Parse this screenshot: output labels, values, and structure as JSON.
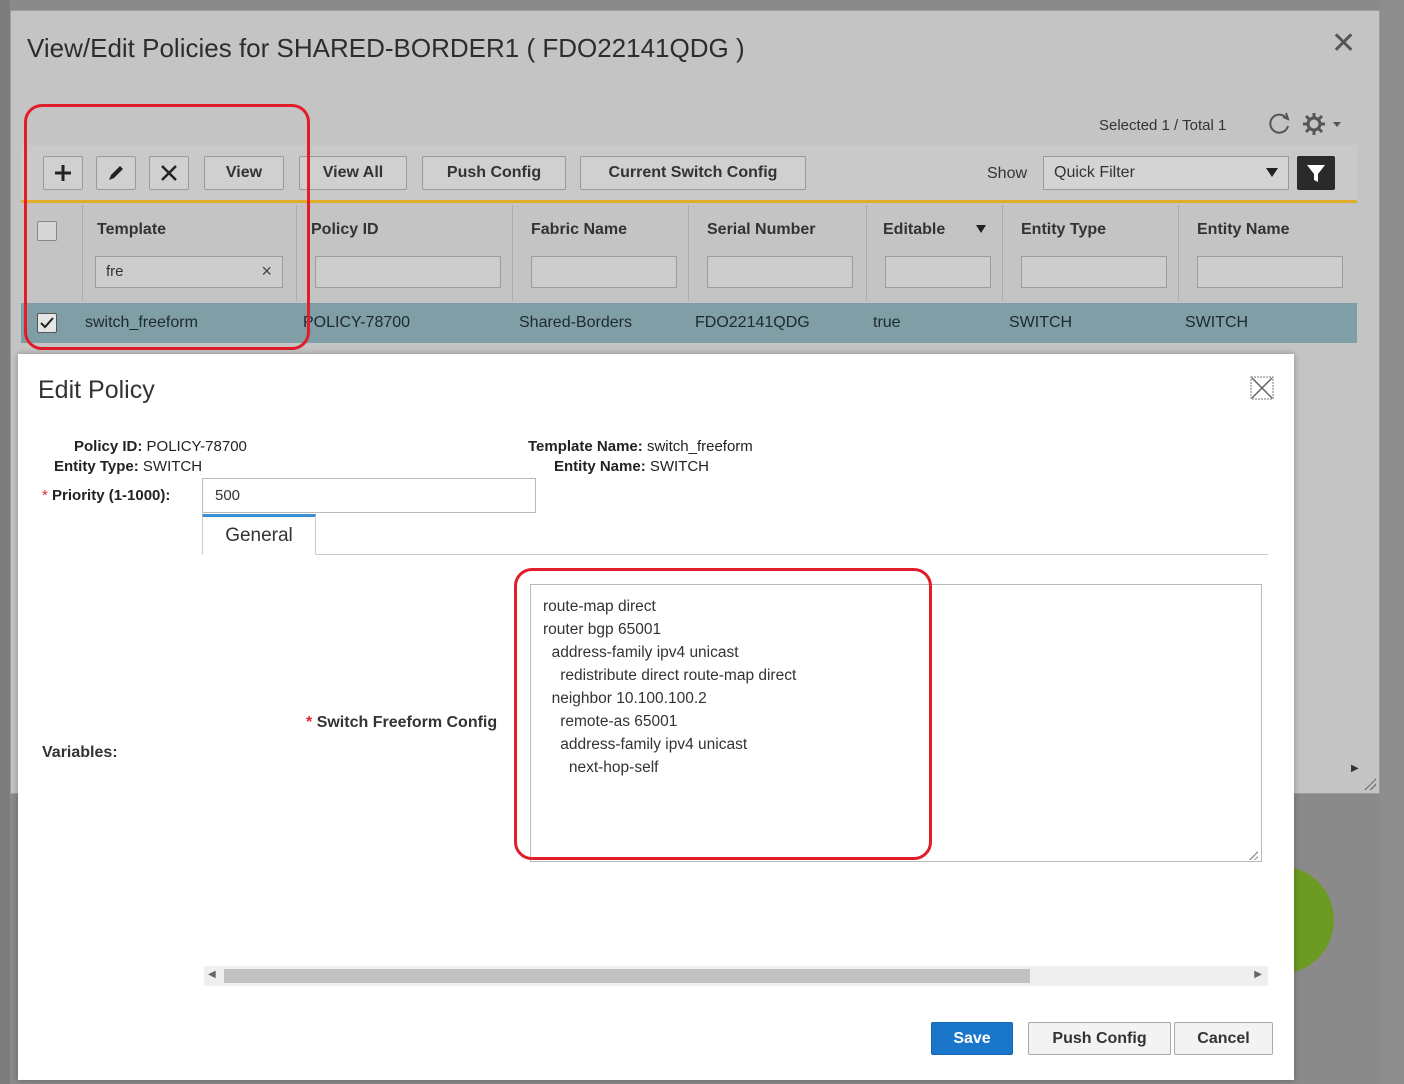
{
  "outer_dialog": {
    "title": "View/Edit Policies for SHARED-BORDER1 ( FDO22141QDG )",
    "close_glyph": "✕",
    "selected_info": "Selected 1 / Total 1"
  },
  "toolbar": {
    "add_icon": "plus-icon",
    "edit_icon": "pencil-icon",
    "delete_icon": "x-icon",
    "view_label": "View",
    "view_all_label": "View All",
    "push_config_label": "Push Config",
    "current_switch_config_label": "Current Switch Config",
    "show_label": "Show",
    "quick_filter_value": "Quick Filter"
  },
  "table": {
    "columns": [
      "Template",
      "Policy ID",
      "Fabric Name",
      "Serial Number",
      "Editable",
      "Entity Type",
      "Entity Name"
    ],
    "template_filter_value": "fre",
    "rows": [
      {
        "template": "switch_freeform",
        "policy_id": "POLICY-78700",
        "fabric_name": "Shared-Borders",
        "serial_number": "FDO22141QDG",
        "editable": "true",
        "entity_type": "SWITCH",
        "entity_name": "SWITCH",
        "checked": true
      }
    ]
  },
  "edit_policy": {
    "title": "Edit Policy",
    "policy_id_label": "Policy ID:",
    "policy_id_value": "POLICY-78700",
    "entity_type_label": "Entity Type:",
    "entity_type_value": "SWITCH",
    "template_name_label": "Template Name:",
    "template_name_value": "switch_freeform",
    "entity_name_label": "Entity Name:",
    "entity_name_value": "SWITCH",
    "required_mark": "*",
    "priority_label": "Priority (1-1000):",
    "priority_value": "500",
    "tab_general": "General",
    "variables_label": "Variables:",
    "switch_freeform_label": "Switch Freeform Config",
    "config_text": "route-map direct\nrouter bgp 65001\n  address-family ipv4 unicast\n    redistribute direct route-map direct\n  neighbor 10.100.100.2\n    remote-as 65001\n    address-family ipv4 unicast\n      next-hop-self",
    "save_label": "Save",
    "push_config_label": "Push Config",
    "cancel_label": "Cancel"
  },
  "colors": {
    "save_button": "#1976c9",
    "selected_row": "#7f9ea6",
    "highlight": "#e11d2a",
    "toolbar_accent": "#e0ad2b"
  }
}
